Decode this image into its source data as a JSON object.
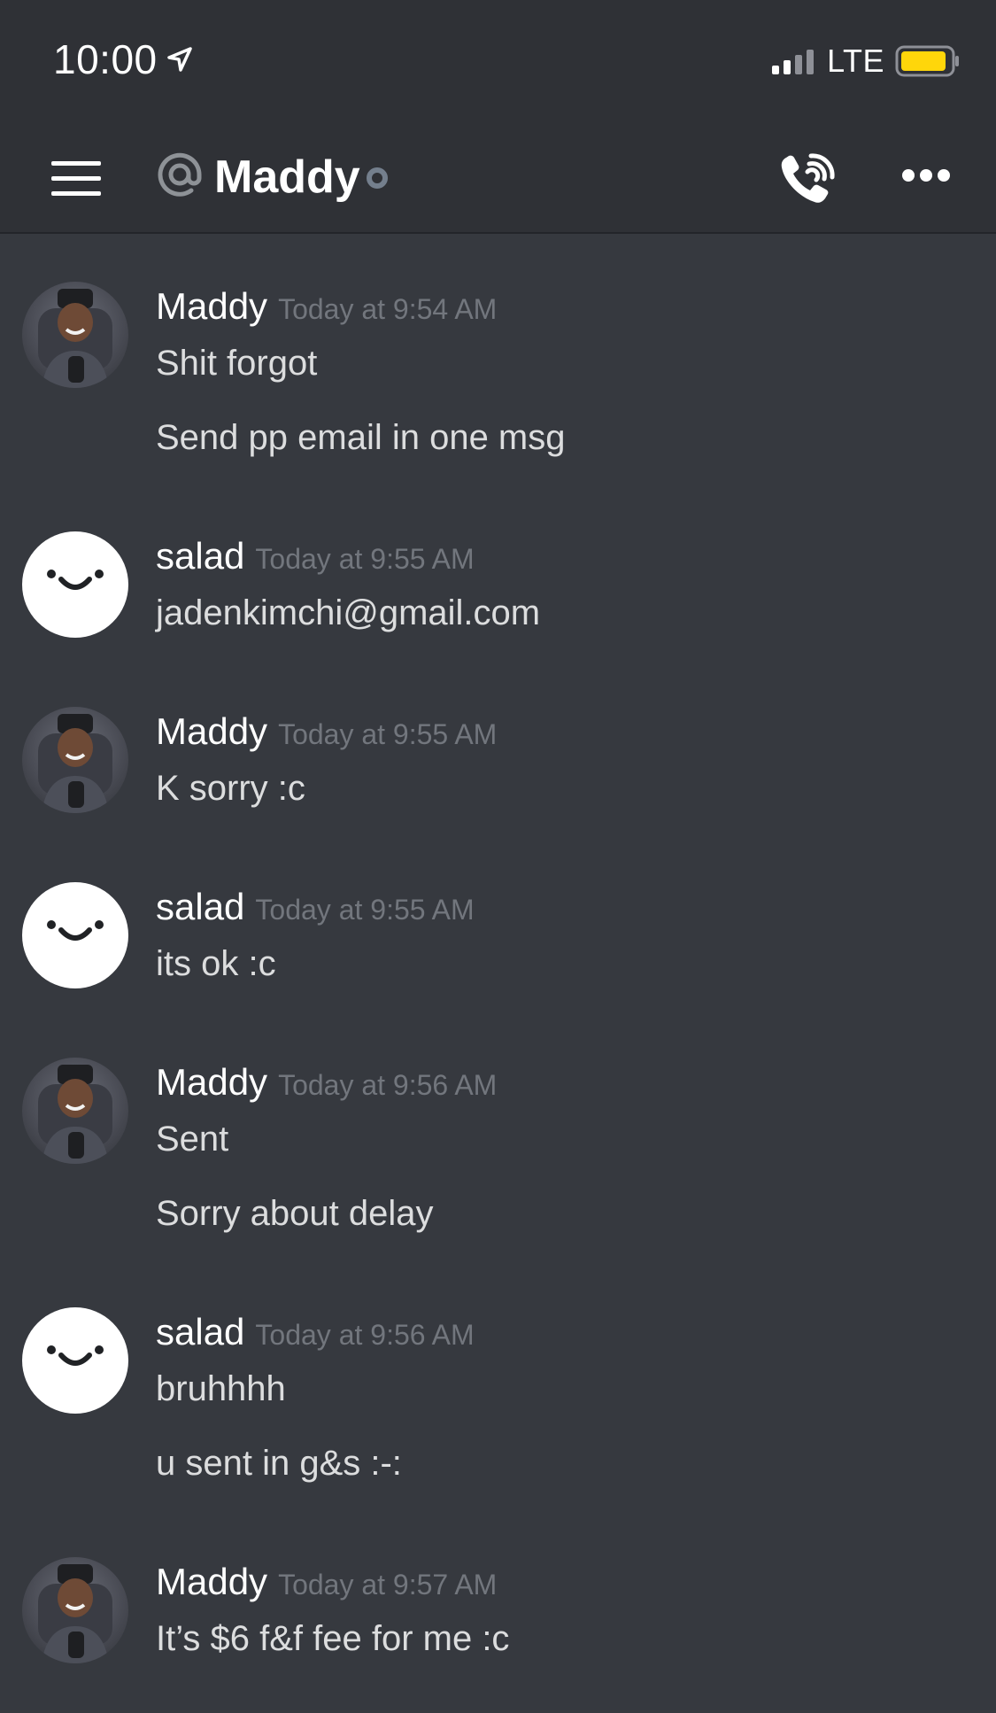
{
  "status_bar": {
    "time": "10:00",
    "network": "LTE",
    "battery_color": "#ffd60a"
  },
  "header": {
    "channel_name": "Maddy"
  },
  "messages": [
    {
      "author": "Maddy",
      "timestamp": "Today at 9:54 AM",
      "lines": [
        "Shit forgot",
        "Send pp email in one msg"
      ]
    },
    {
      "author": "salad",
      "timestamp": "Today at 9:55 AM",
      "lines": [
        "jadenkimchi@gmail.com"
      ]
    },
    {
      "author": "Maddy",
      "timestamp": "Today at 9:55 AM",
      "lines": [
        "K sorry :c"
      ]
    },
    {
      "author": "salad",
      "timestamp": "Today at 9:55 AM",
      "lines": [
        "its ok :c"
      ]
    },
    {
      "author": "Maddy",
      "timestamp": "Today at 9:56 AM",
      "lines": [
        "Sent",
        "Sorry about delay"
      ]
    },
    {
      "author": "salad",
      "timestamp": "Today at 9:56 AM",
      "lines": [
        "bruhhhh",
        "u sent in g&s :-:"
      ]
    },
    {
      "author": "Maddy",
      "timestamp": "Today at 9:57 AM",
      "lines": [
        "It’s $6 f&f fee for me :c"
      ]
    }
  ],
  "colors": {
    "background": "#36393f",
    "header_bg": "#2f3136",
    "timestamp": "#72767d",
    "text": "#dcddde"
  }
}
